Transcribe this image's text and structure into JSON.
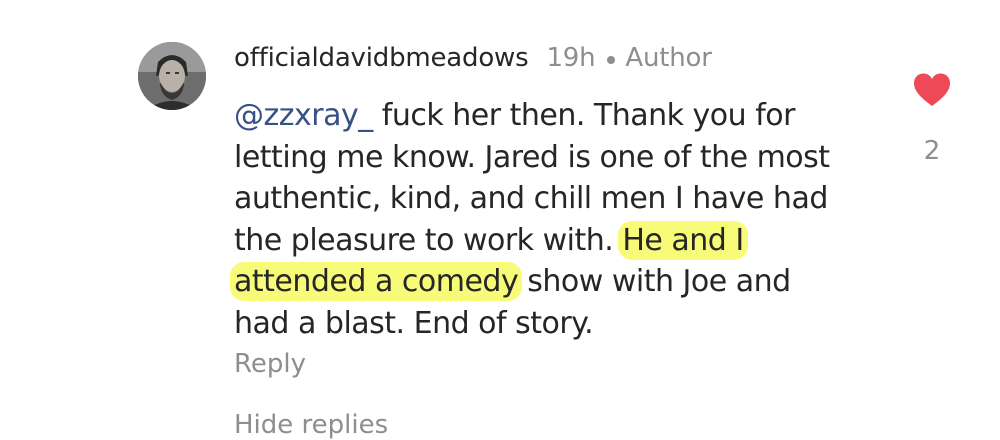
{
  "comment": {
    "username": "officialdavidbmeadows",
    "time": "19h",
    "author_badge": "Author",
    "mention": "@zzxray_",
    "text_lines": [
      " fuck her then. Thank you for",
      "letting me know. Jared is one of the most",
      "authentic, kind, and chill men I have had",
      "the pleasure to work with. ",
      "He and I",
      "attended a comedy",
      " show with Joe and",
      "had a blast. End of story."
    ],
    "reply_label": "Reply",
    "hidden_replies_label": "Hide replies",
    "like_count": "2",
    "avatar_icon": "profile-photo",
    "like_icon": "heart-filled-icon",
    "like_color": "#ed4956",
    "highlight_color": "#f6fa60"
  }
}
